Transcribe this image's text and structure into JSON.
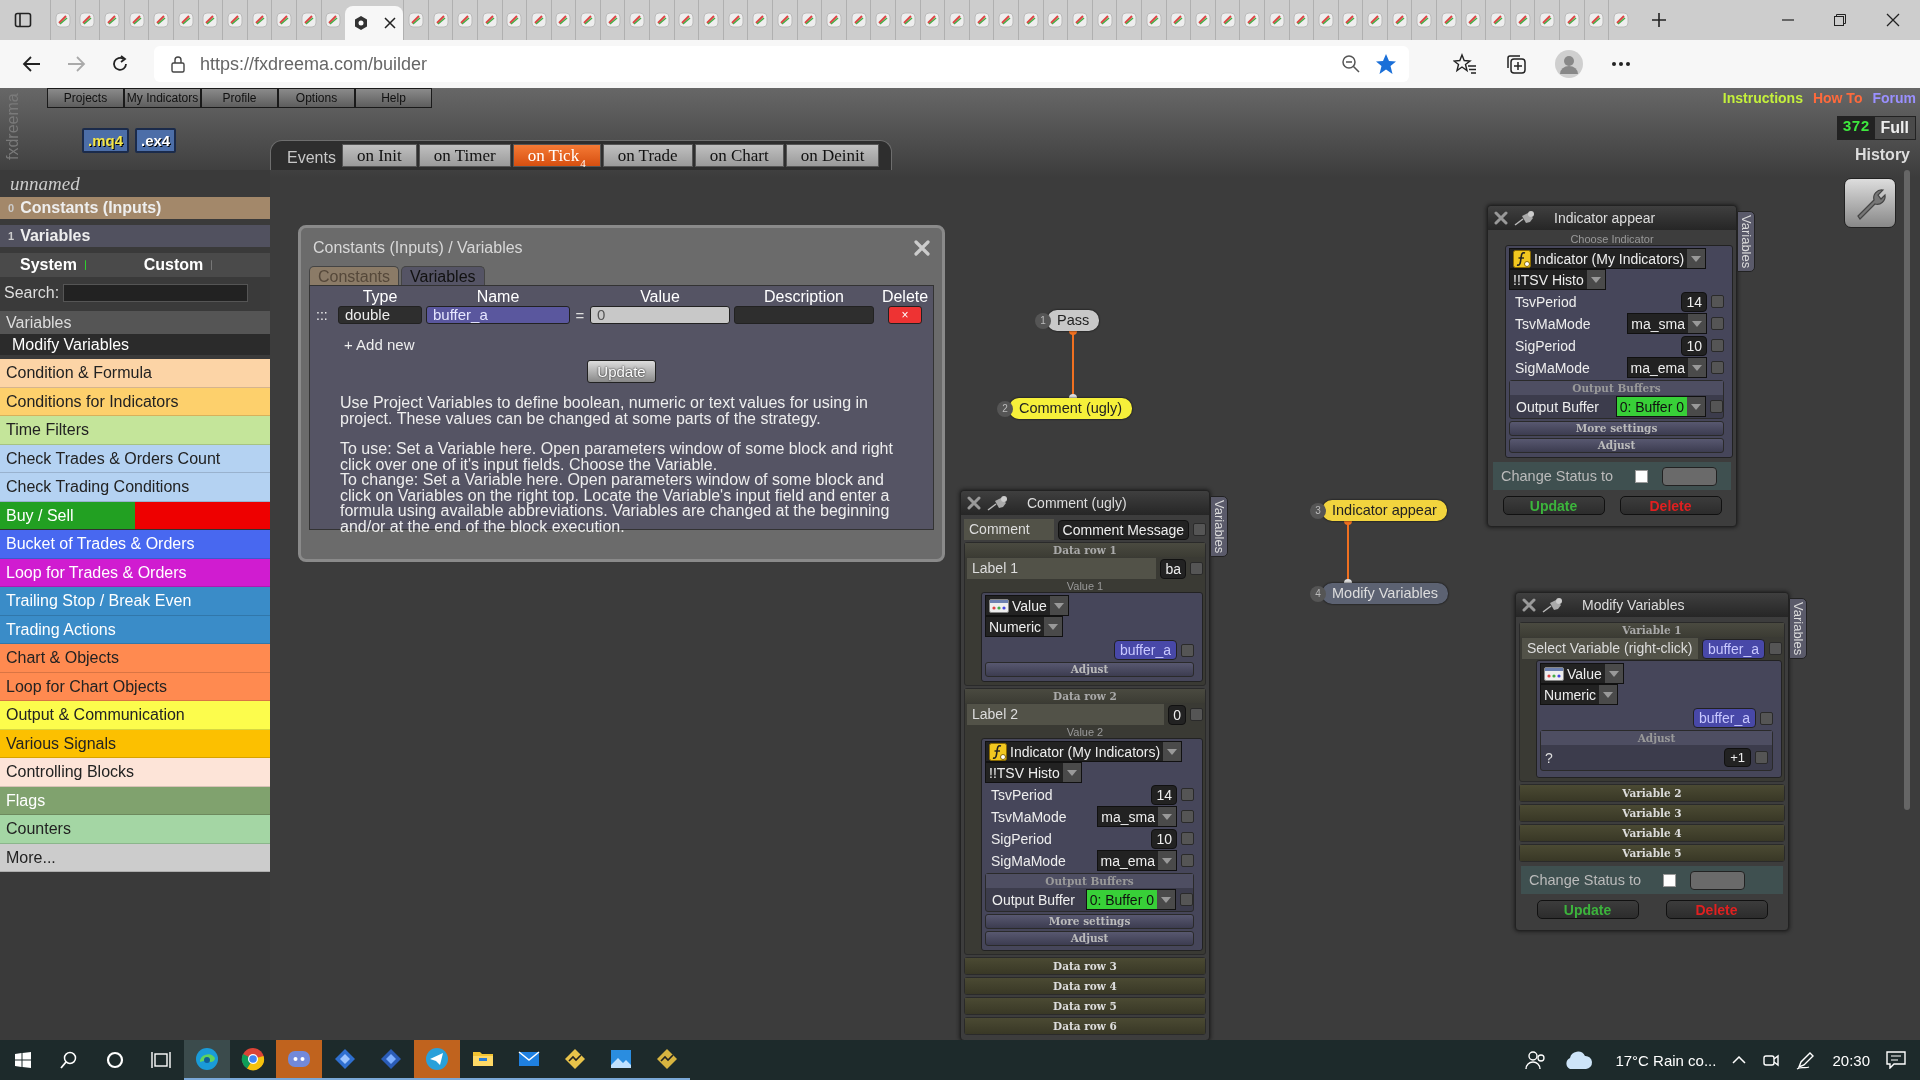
{
  "browser": {
    "tabs": [
      {
        "selected": false
      },
      {
        "selected": false
      },
      {
        "selected": false
      },
      {
        "selected": false
      },
      {
        "selected": false
      },
      {
        "selected": false
      },
      {
        "selected": false
      },
      {
        "selected": false
      },
      {
        "selected": false
      },
      {
        "selected": false
      },
      {
        "selected": false
      },
      {
        "selected": false
      },
      {
        "selected": true
      },
      {
        "selected": false
      },
      {
        "selected": false
      },
      {
        "selected": false
      },
      {
        "selected": false
      },
      {
        "selected": false
      },
      {
        "selected": false
      },
      {
        "selected": false
      },
      {
        "selected": false
      },
      {
        "selected": false
      },
      {
        "selected": false
      },
      {
        "selected": false
      },
      {
        "selected": false
      },
      {
        "selected": false
      },
      {
        "selected": false
      },
      {
        "selected": false
      },
      {
        "selected": false
      },
      {
        "selected": false
      },
      {
        "selected": false
      },
      {
        "selected": false
      },
      {
        "selected": false
      },
      {
        "selected": false
      },
      {
        "selected": false
      },
      {
        "selected": false
      },
      {
        "selected": false
      },
      {
        "selected": false
      },
      {
        "selected": false
      },
      {
        "selected": false
      },
      {
        "selected": false
      },
      {
        "selected": false
      },
      {
        "selected": false
      },
      {
        "selected": false
      },
      {
        "selected": false
      },
      {
        "selected": false
      },
      {
        "selected": false
      },
      {
        "selected": false
      },
      {
        "selected": false
      },
      {
        "selected": false
      },
      {
        "selected": false
      },
      {
        "selected": false
      },
      {
        "selected": false
      },
      {
        "selected": false
      },
      {
        "selected": false
      },
      {
        "selected": false
      },
      {
        "selected": false
      },
      {
        "selected": false
      },
      {
        "selected": false
      },
      {
        "selected": false
      },
      {
        "selected": false
      },
      {
        "selected": false
      },
      {
        "selected": false
      }
    ],
    "url": "https://fxdreema.com/builder"
  },
  "header": {
    "logo": "fxdreema",
    "menu": [
      {
        "label": "Projects"
      },
      {
        "label": "My Indicators"
      },
      {
        "label": "Profile"
      },
      {
        "label": "Options"
      },
      {
        "label": "Help"
      }
    ],
    "exports": [
      ".mq4",
      ".ex4"
    ],
    "events": {
      "label": "Events",
      "tabs": [
        {
          "label": "on Init",
          "selected": false
        },
        {
          "label": "on Timer",
          "selected": false
        },
        {
          "label": "on Tick",
          "selected": true,
          "badge": "4"
        },
        {
          "label": "on Trade",
          "selected": false
        },
        {
          "label": "on Chart",
          "selected": false
        },
        {
          "label": "on Deinit",
          "selected": false
        }
      ]
    },
    "links": [
      {
        "label": "Instructions",
        "color": "#c4f03c"
      },
      {
        "label": "How To",
        "color": "#ff6a3c"
      },
      {
        "label": "Forum",
        "color": "#9a90ff"
      }
    ],
    "counter": "372",
    "mode": "Full",
    "history": "History"
  },
  "sidebar": {
    "project": "unnamed",
    "sections": [
      {
        "index": "0",
        "label": "Constants (Inputs)",
        "color": "#a3886a"
      },
      {
        "index": "1",
        "label": "Variables",
        "color": "#51515f"
      }
    ],
    "toggles": [
      {
        "label": "System",
        "on": true
      },
      {
        "label": "Custom",
        "on": false
      }
    ],
    "search_label": "Search:",
    "list_header": "Variables",
    "list_items": [
      {
        "label": "Modify Variables"
      }
    ],
    "categories": [
      {
        "label": "Condition & Formula",
        "color": "#fcd4a6"
      },
      {
        "label": "Conditions for Indicators",
        "color": "#fdd06c"
      },
      {
        "label": "Time Filters",
        "color": "#c4e59a"
      },
      {
        "label": "Check Trades & Orders Count",
        "color": "#b4d2f2"
      },
      {
        "label": "Check Trading Conditions",
        "color": "#b4d2f2"
      },
      {
        "label": "Buy / Sell",
        "segments": [
          {
            "color": "#22a022"
          },
          {
            "color": "#ee0000"
          }
        ]
      },
      {
        "label": "Bucket of Trades & Orders",
        "color": "#4868f0"
      },
      {
        "label": "Loop for Trades & Orders",
        "color": "#d01cd0"
      },
      {
        "label": "Trailing Stop / Break Even",
        "color": "#3a8cc8"
      },
      {
        "label": "Trading Actions",
        "color": "#3a8cc8"
      },
      {
        "label": "Chart & Objects",
        "color": "#ff8a50"
      },
      {
        "label": "Loop for Chart Objects",
        "color": "#ff8a50"
      },
      {
        "label": "Output & Communication",
        "color": "#fcfc4c"
      },
      {
        "label": "Various Signals",
        "color": "#fcc000"
      },
      {
        "label": "Controlling Blocks",
        "color": "#fde4d8"
      },
      {
        "label": "Flags",
        "color": "#80a26e"
      },
      {
        "label": "Counters",
        "color": "#a4d6a4"
      },
      {
        "label": "More...",
        "color": "#cccccc"
      }
    ]
  },
  "dialog": {
    "title": "Constants (Inputs) / Variables",
    "tabs": [
      {
        "label": "Constants",
        "selected": false
      },
      {
        "label": "Variables",
        "selected": true
      }
    ],
    "columns": [
      "Type",
      "Name",
      "Value",
      "Description",
      "Delete"
    ],
    "rows": [
      {
        "handle": ":::",
        "type": "double",
        "name": "buffer_a",
        "equals": "=",
        "value": "0",
        "delete": "×"
      }
    ],
    "add_new": "+ Add new",
    "update": "Update",
    "help": [
      "Use Project Variables to define boolean, numeric or text values for using in project. These values can be changed at some parts of the strategy.",
      "To use: Set a Variable here. Open parameters window of some block and right click over one of it's input fields. Choose the Variable.",
      "To change: Set a Variable here. Open parameters window of some block and click on Variables on the right top. Locate the Variable's input field and enter a formula using available abbreviations. Variables are changed at the beginning and/or at the end of the block execution."
    ]
  },
  "flow": {
    "nodes": [
      {
        "number": "1",
        "label": "Pass",
        "color": "#c8c8c8"
      },
      {
        "number": "2",
        "label": "Comment (ugly)",
        "color": "#f6f03a"
      },
      {
        "number": "3",
        "label": "Indicator appear",
        "color": "#f2d43e"
      },
      {
        "number": "4",
        "label": "Modify Variables",
        "color": "#5c6272"
      }
    ]
  },
  "panels": [
    {
      "title": "Comment (ugly)",
      "side_tab": "Variables",
      "rows": [
        {
          "kind": "field",
          "label": "Comment",
          "value": "Comment Message",
          "checked": false
        },
        {
          "kind": "section",
          "label": "Data row 1",
          "expanded": true,
          "rows": [
            {
              "kind": "field",
              "label": "Label 1",
              "value": "ba",
              "checked": false
            },
            {
              "kind": "caption",
              "label": "Value 1"
            },
            {
              "kind": "group",
              "rows": [
                {
                  "kind": "value_select",
                  "value": "Value"
                },
                {
                  "kind": "select",
                  "value": "Numeric"
                },
                {
                  "kind": "chip",
                  "value": "buffer_a",
                  "checked": false
                },
                {
                  "kind": "bar",
                  "label": "Adjust"
                }
              ]
            }
          ]
        },
        {
          "kind": "section",
          "label": "Data row 2",
          "expanded": true,
          "rows": [
            {
              "kind": "field",
              "label": "Label 2",
              "value": "0",
              "checked": false
            },
            {
              "kind": "caption",
              "label": "Value 2"
            },
            {
              "kind": "group",
              "rows": [
                {
                  "kind": "indicator_select",
                  "value": "Indicator (My Indicators)"
                },
                {
                  "kind": "select",
                  "value": "!!TSV Histo"
                },
                {
                  "kind": "param",
                  "label": "TsvPeriod",
                  "value": "14",
                  "dropdown": false,
                  "checked": false
                },
                {
                  "kind": "param",
                  "label": "TsvMaMode",
                  "value": "ma_sma",
                  "dropdown": true,
                  "checked": false
                },
                {
                  "kind": "param",
                  "label": "SigPeriod",
                  "value": "10",
                  "dropdown": false,
                  "checked": false
                },
                {
                  "kind": "param",
                  "label": "SigMaMode",
                  "value": "ma_ema",
                  "dropdown": true,
                  "checked": false
                },
                {
                  "kind": "subsection",
                  "label": "Output Buffers",
                  "rows": [
                    {
                      "kind": "output",
                      "label": "Output Buffer",
                      "value": "0: Buffer 0",
                      "checked": false
                    }
                  ]
                },
                {
                  "kind": "bar",
                  "label": "More settings"
                },
                {
                  "kind": "bar",
                  "label": "Adjust"
                }
              ]
            }
          ]
        },
        {
          "kind": "section",
          "label": "Data row 3",
          "expanded": false
        },
        {
          "kind": "section",
          "label": "Data row 4",
          "expanded": false
        },
        {
          "kind": "section",
          "label": "Data row 5",
          "expanded": false
        },
        {
          "kind": "section",
          "label": "Data row 6",
          "expanded": false
        }
      ]
    },
    {
      "title": "Indicator appear",
      "side_tab": "Variables",
      "rows": [
        {
          "kind": "caption",
          "label": "Choose Indicator"
        },
        {
          "kind": "group",
          "rows": [
            {
              "kind": "indicator_select",
              "value": "Indicator (My Indicators)"
            },
            {
              "kind": "select",
              "value": "!!TSV Histo"
            },
            {
              "kind": "param",
              "label": "TsvPeriod",
              "value": "14",
              "dropdown": false,
              "checked": false
            },
            {
              "kind": "param",
              "label": "TsvMaMode",
              "value": "ma_sma",
              "dropdown": true,
              "checked": false
            },
            {
              "kind": "param",
              "label": "SigPeriod",
              "value": "10",
              "dropdown": false,
              "checked": false
            },
            {
              "kind": "param",
              "label": "SigMaMode",
              "value": "ma_ema",
              "dropdown": true,
              "checked": false
            },
            {
              "kind": "subsection",
              "label": "Output Buffers",
              "rows": [
                {
                  "kind": "output",
                  "label": "Output Buffer",
                  "value": "0: Buffer 0",
                  "checked": false
                }
              ]
            },
            {
              "kind": "bar",
              "label": "More settings"
            },
            {
              "kind": "bar",
              "label": "Adjust"
            }
          ]
        },
        {
          "kind": "status",
          "label": "Change Status to",
          "checked": false
        },
        {
          "kind": "actions",
          "buttons": [
            {
              "label": "Update",
              "kind": "update"
            },
            {
              "label": "Delete",
              "kind": "delete"
            }
          ]
        }
      ]
    },
    {
      "title": "Modify Variables",
      "side_tab": "Variables",
      "rows": [
        {
          "kind": "section",
          "label": "Variable 1",
          "expanded": true,
          "rows": [
            {
              "kind": "field",
              "label": "Select Variable (right-click)",
              "value": "buffer_a",
              "variable": true,
              "checked": false
            },
            {
              "kind": "group",
              "rows": [
                {
                  "kind": "value_select",
                  "value": "Value"
                },
                {
                  "kind": "select",
                  "value": "Numeric"
                },
                {
                  "kind": "chip",
                  "value": "buffer_a",
                  "checked": false
                },
                {
                  "kind": "subsection",
                  "label": "Adjust",
                  "rows": [
                    {
                      "kind": "formula",
                      "value": "?",
                      "button": "+1",
                      "checked": false
                    }
                  ]
                }
              ]
            }
          ]
        },
        {
          "kind": "section",
          "label": "Variable 2",
          "expanded": false
        },
        {
          "kind": "section",
          "label": "Variable 3",
          "expanded": false
        },
        {
          "kind": "section",
          "label": "Variable 4",
          "expanded": false
        },
        {
          "kind": "section",
          "label": "Variable 5",
          "expanded": false
        },
        {
          "kind": "status",
          "label": "Change Status to",
          "checked": false
        },
        {
          "kind": "actions",
          "buttons": [
            {
              "label": "Update",
              "kind": "update"
            },
            {
              "label": "Delete",
              "kind": "delete"
            }
          ]
        }
      ]
    }
  ],
  "taskbar": {
    "apps": [
      {
        "open": true,
        "active": true,
        "attention": false
      },
      {
        "open": true,
        "active": false,
        "attention": false
      },
      {
        "open": true,
        "active": false,
        "attention": true
      },
      {
        "open": true,
        "active": false,
        "attention": false
      },
      {
        "open": true,
        "active": false,
        "attention": false
      },
      {
        "open": true,
        "active": false,
        "attention": true
      },
      {
        "open": true,
        "active": false,
        "attention": false
      },
      {
        "open": true,
        "active": false,
        "attention": false
      },
      {
        "open": true,
        "active": false,
        "attention": false
      },
      {
        "open": true,
        "active": false,
        "attention": false
      },
      {
        "open": true,
        "active": false,
        "attention": false
      }
    ],
    "weather": "17°C Rain co...",
    "time": "20:30"
  }
}
